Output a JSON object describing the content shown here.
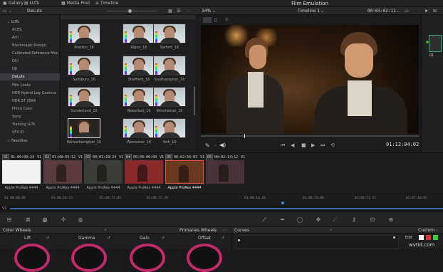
{
  "topbar": {
    "gallery": "Gallery",
    "luts": "LUTs",
    "media_pool": "Media Pool",
    "timeline": "Timeline",
    "title": "Film Emulation"
  },
  "lutbar": {
    "current_folder": "DeLuts",
    "zoom": "34%",
    "timeline_name": "Timeline 1",
    "timecode": "00:03:02:11",
    "clip_label": "Clip"
  },
  "sidebar": {
    "items": [
      {
        "label": "LUTs",
        "folder": true
      },
      {
        "label": "ACES"
      },
      {
        "label": "Arri"
      },
      {
        "label": "Blackmagic Design"
      },
      {
        "label": "Calibrated Reference Mon..."
      },
      {
        "label": "DCI"
      },
      {
        "label": "DJI"
      },
      {
        "label": "DeLuts",
        "active": true
      },
      {
        "label": "Film Looks"
      },
      {
        "label": "HDR Hybrid Log-Gamma"
      },
      {
        "label": "HDR ST 2084"
      },
      {
        "label": "Phlim Color"
      },
      {
        "label": "Sony"
      },
      {
        "label": "Training LUTs"
      },
      {
        "label": "VFX IO"
      },
      {
        "label": "Favorites",
        "folder": true
      }
    ]
  },
  "luts": [
    {
      "name": "Preston_16"
    },
    {
      "name": "Ripon_16"
    },
    {
      "name": "Salford_16"
    },
    {
      "name": "Salisbury_16"
    },
    {
      "name": "Sheffield_16"
    },
    {
      "name": "Southampton_16"
    },
    {
      "name": "Sunderland_16"
    },
    {
      "name": "Wakefield_16"
    },
    {
      "name": "Winchester_16"
    },
    {
      "name": "Wolverhampton_16"
    },
    {
      "name": "Worcester_16"
    },
    {
      "name": "York_16"
    }
  ],
  "viewer": {
    "timecode": "01:12:04:02"
  },
  "clips": [
    {
      "num": "01",
      "tc": "01:00:00:24",
      "track": "V1",
      "codec": "Apple ProRes 4444",
      "color": "#f2f2f2"
    },
    {
      "num": "02",
      "tc": "01:08:04:12",
      "track": "V1",
      "codec": "Apple ProRes 4444",
      "color": "#5a3a3a"
    },
    {
      "num": "03",
      "tc": "00:01:29:24",
      "track": "V1",
      "codec": "Apple ProRes 4444",
      "color": "#3a3c3a"
    },
    {
      "num": "04",
      "tc": "00:00:00:00",
      "track": "V1",
      "codec": "Apple ProRes 4444",
      "color": "#8a2a2a"
    },
    {
      "num": "05",
      "tc": "00:02:56:03",
      "track": "V1",
      "codec": "Apple ProRes 4444",
      "color": "#6a3a20",
      "selected": true
    },
    {
      "num": "06",
      "tc": "00:02:14:12",
      "track": "V1",
      "codec": "",
      "color": "#4a3038"
    }
  ],
  "ruler": [
    "01:00:00:00",
    "01:00:18:15",
    "01:00:37:05",
    "01:00:55:20",
    "01:00:14:10",
    "01:00:33:00",
    "01:00:51:15",
    "01:07:10:05"
  ],
  "panels": {
    "color_wheels": "Color Wheels",
    "primaries": "Primaries Wheels",
    "curves": "Curves",
    "custom": "Custom",
    "edit": "Edit",
    "lift": "Lift",
    "gamma": "Gamma",
    "gain": "Gain",
    "offset": "Offset"
  },
  "watermark": "wvtid.com"
}
